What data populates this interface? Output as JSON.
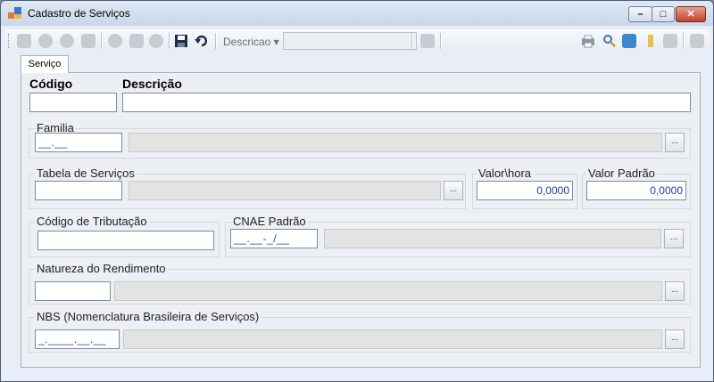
{
  "window": {
    "title": "Cadastro de Serviços",
    "minimize": "–",
    "maximize": "□",
    "close": "✕"
  },
  "toolbar": {
    "search_label": "Descricao ▾",
    "search_value": ""
  },
  "tabs": [
    {
      "label": "Serviço"
    }
  ],
  "form": {
    "codigo_label": "Código",
    "descricao_label": "Descrição",
    "codigo_value": "",
    "descricao_value": "",
    "familia": {
      "label": "Familia",
      "code": "__.__",
      "description": ""
    },
    "tabela": {
      "label": "Tabela de Serviços",
      "code": "",
      "description": ""
    },
    "valor_hora": {
      "label": "Valor\\hora",
      "value": "0,0000"
    },
    "valor_padrao": {
      "label": "Valor Padrão",
      "value": "0,0000"
    },
    "tributacao": {
      "label": "Código de Tributação",
      "value": ""
    },
    "cnae": {
      "label": "CNAE Padrão",
      "code": "__.__-_/__",
      "description": ""
    },
    "natureza": {
      "label": "Natureza do Rendimento",
      "code": "",
      "description": ""
    },
    "nbs": {
      "label": "NBS (Nomenclatura Brasileira de Serviços)",
      "code": "_.____.__.__",
      "description": ""
    },
    "lookup_button": "..."
  }
}
